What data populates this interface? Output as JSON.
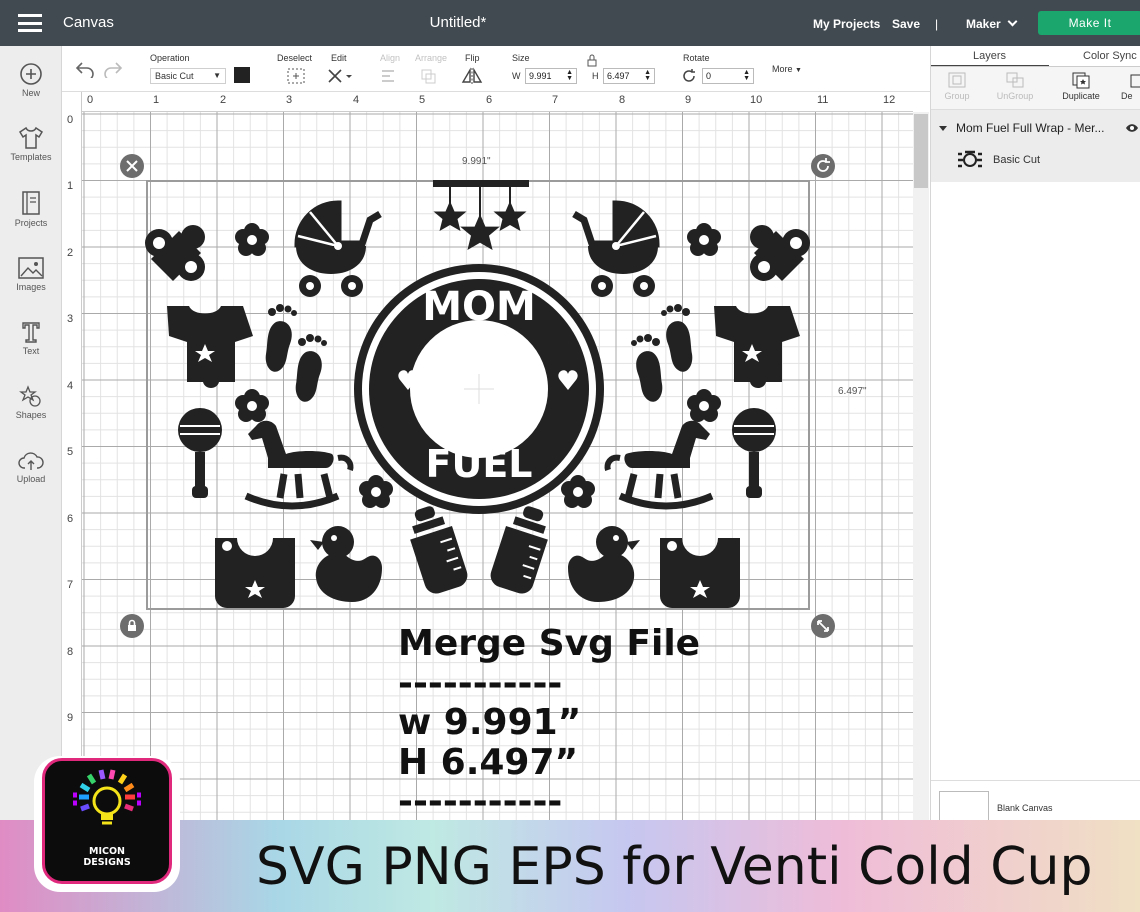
{
  "header": {
    "app_title": "Canvas",
    "doc_title": "Untitled*",
    "my_projects": "My Projects",
    "save": "Save",
    "separator": "|",
    "machine": "Maker",
    "make_it": "Make It"
  },
  "sidebar": {
    "items": [
      {
        "label": "New",
        "icon": "plus-circle-icon"
      },
      {
        "label": "Templates",
        "icon": "shirt-icon"
      },
      {
        "label": "Projects",
        "icon": "book-icon"
      },
      {
        "label": "Images",
        "icon": "image-icon"
      },
      {
        "label": "Text",
        "icon": "text-t-icon"
      },
      {
        "label": "Shapes",
        "icon": "shapes-icon"
      },
      {
        "label": "Upload",
        "icon": "upload-cloud-icon"
      }
    ]
  },
  "toolbar": {
    "operation_label": "Operation",
    "operation_value": "Basic Cut",
    "deselect": "Deselect",
    "edit": "Edit",
    "align": "Align",
    "arrange": "Arrange",
    "flip": "Flip",
    "size_label": "Size",
    "w_label": "W",
    "w_value": "9.991",
    "h_label": "H",
    "h_value": "6.497",
    "rotate_label": "Rotate",
    "rotate_value": "0",
    "more": "More"
  },
  "ruler": {
    "top": [
      "0",
      "1",
      "2",
      "3",
      "4",
      "5",
      "6",
      "7",
      "8",
      "9",
      "10",
      "11",
      "12"
    ],
    "left": [
      "0",
      "1",
      "2",
      "3",
      "4",
      "5",
      "6",
      "7",
      "8",
      "9"
    ]
  },
  "canvas": {
    "width_label": "9.991\"",
    "height_label": "6.497\"",
    "design_text_top": "MOM",
    "design_text_bottom": "FUEL"
  },
  "overlay_text": {
    "line1": "Merge Svg File",
    "line2": "-----------",
    "line3": "w 9.991”",
    "line4": "H 6.497”",
    "line5": "-----------"
  },
  "right_panel": {
    "tabs": [
      "Layers",
      "Color Sync"
    ],
    "tools": [
      "Group",
      "UnGroup",
      "Duplicate",
      "De"
    ],
    "layer_name": "Mom Fuel Full Wrap - Mer...",
    "layer_sub": "Basic Cut",
    "blank_canvas": "Blank Canvas"
  },
  "banner": {
    "text": "SVG PNG EPS for Venti Cold Cup",
    "logo_line1": "MICON",
    "logo_line2": "DESIGNS"
  },
  "colors": {
    "topbar": "#414a50",
    "make_it": "#1ba66d",
    "design": "#222222",
    "logo_border": "#e0287d"
  }
}
